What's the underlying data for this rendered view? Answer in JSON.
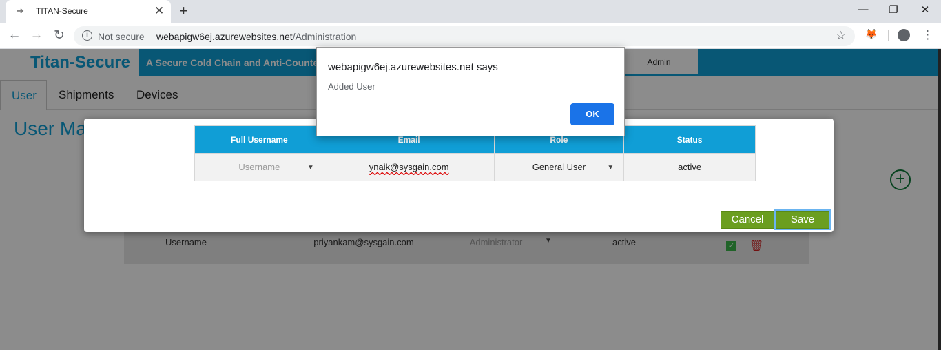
{
  "browser": {
    "tab_title": "TITAN-Secure",
    "new_tab": "+",
    "close_tab": "✕",
    "not_secure": "Not secure",
    "url_host": "webapigw6ej.azurewebsites.net",
    "url_path": "/Administration",
    "window_controls": {
      "minimize": "—",
      "maximize": "❐",
      "close": "✕"
    }
  },
  "app": {
    "logo": "Titan-Secure",
    "tagline": "A Secure Cold Chain and Anti-Counterfeiting",
    "admin_label": "Admin",
    "accent_color": "#109ed6",
    "button_color": "#6b9e1f"
  },
  "nav": {
    "tabs": [
      {
        "label": "User"
      },
      {
        "label": "Shipments"
      },
      {
        "label": "Devices"
      }
    ]
  },
  "page": {
    "title": "User Management",
    "add_icon": "+"
  },
  "background_row": {
    "username": "Username",
    "email": "priyankam@sysgain.com",
    "role": "Administrator",
    "status": "active"
  },
  "modal": {
    "headers": [
      "Full Username",
      "Email",
      "Role",
      "Status"
    ],
    "row": {
      "username_placeholder": "Username",
      "email": "ynaik@sysgain.com",
      "role": "General User",
      "status": "active"
    },
    "cancel_label": "Cancel",
    "save_label": "Save"
  },
  "alert": {
    "title": "webapigw6ej.azurewebsites.net says",
    "message": "Added User",
    "ok_label": "OK"
  }
}
